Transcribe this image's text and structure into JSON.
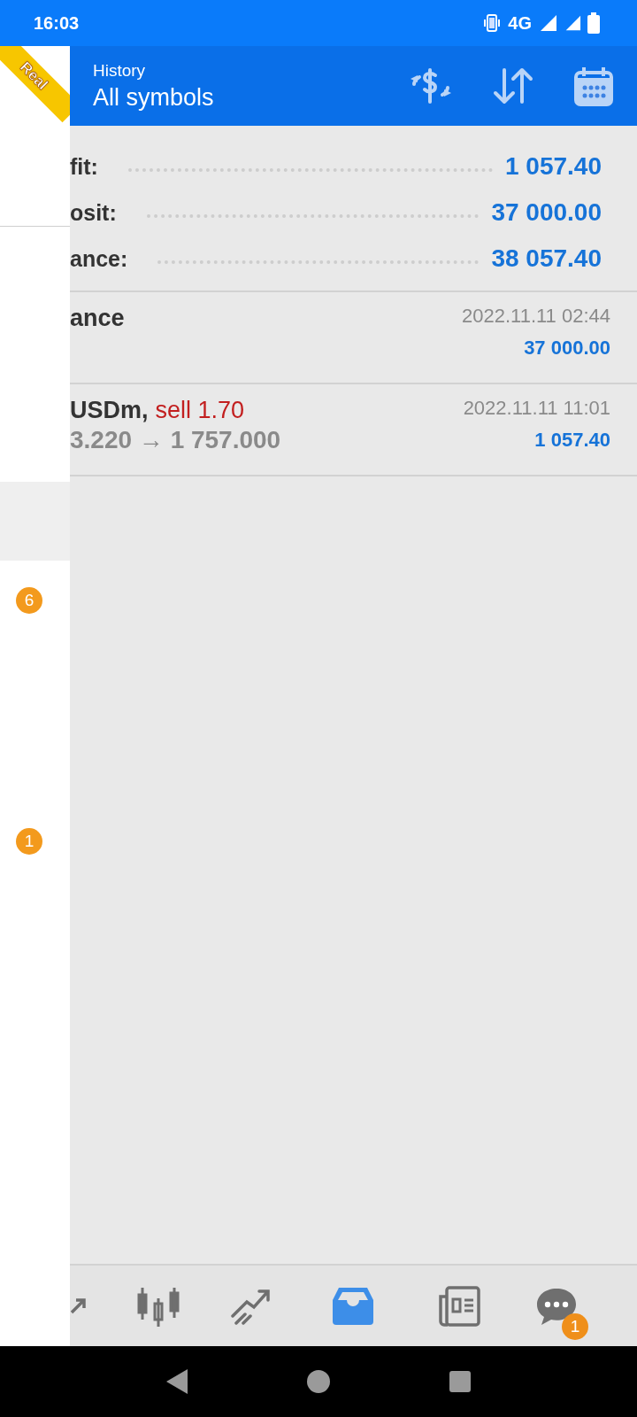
{
  "status_bar": {
    "time": "16:03",
    "network": "4G"
  },
  "drawer": {
    "ribbon": "Real",
    "highlighted_row": true,
    "badges": [
      "6",
      "1"
    ]
  },
  "header": {
    "title": "History",
    "subtitle": "All symbols"
  },
  "summary": [
    {
      "label": "fit:",
      "value": "1 057.40"
    },
    {
      "label": "osit:",
      "value": "37 000.00"
    },
    {
      "label": "ance:",
      "value": "38 057.40"
    }
  ],
  "deals": [
    {
      "kind": "balance",
      "title": "ance",
      "time": "2022.11.11 02:44",
      "amount": "37 000.00"
    },
    {
      "kind": "trade",
      "symbol": "USDm,",
      "side": "sell 1.70",
      "prices": "3.220 → 1 757.000",
      "time": "2022.11.11 11:01",
      "amount": "1 057.40"
    }
  ],
  "bottom_nav": [
    {
      "kind": "quotes",
      "selected": false
    },
    {
      "kind": "chart",
      "selected": false
    },
    {
      "kind": "trade",
      "selected": false
    },
    {
      "kind": "history",
      "selected": true
    },
    {
      "kind": "news",
      "selected": false
    },
    {
      "kind": "chat",
      "selected": false,
      "badge": "1"
    }
  ]
}
